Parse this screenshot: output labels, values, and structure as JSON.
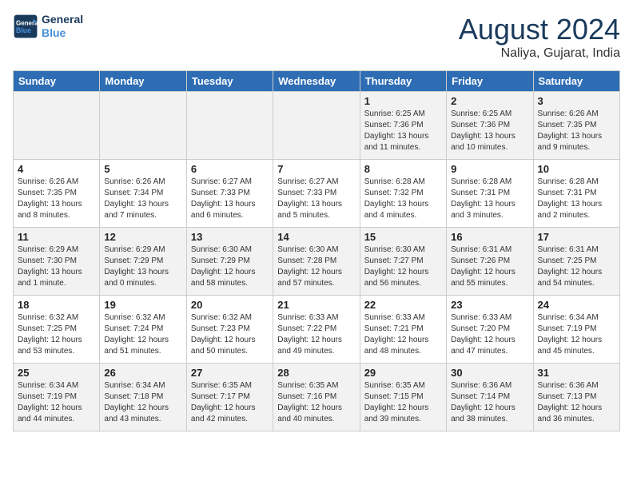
{
  "header": {
    "logo_line1": "General",
    "logo_line2": "Blue",
    "month_year": "August 2024",
    "location": "Naliya, Gujarat, India"
  },
  "days_of_week": [
    "Sunday",
    "Monday",
    "Tuesday",
    "Wednesday",
    "Thursday",
    "Friday",
    "Saturday"
  ],
  "weeks": [
    [
      {
        "day": "",
        "detail": ""
      },
      {
        "day": "",
        "detail": ""
      },
      {
        "day": "",
        "detail": ""
      },
      {
        "day": "",
        "detail": ""
      },
      {
        "day": "1",
        "detail": "Sunrise: 6:25 AM\nSunset: 7:36 PM\nDaylight: 13 hours\nand 11 minutes."
      },
      {
        "day": "2",
        "detail": "Sunrise: 6:25 AM\nSunset: 7:36 PM\nDaylight: 13 hours\nand 10 minutes."
      },
      {
        "day": "3",
        "detail": "Sunrise: 6:26 AM\nSunset: 7:35 PM\nDaylight: 13 hours\nand 9 minutes."
      }
    ],
    [
      {
        "day": "4",
        "detail": "Sunrise: 6:26 AM\nSunset: 7:35 PM\nDaylight: 13 hours\nand 8 minutes."
      },
      {
        "day": "5",
        "detail": "Sunrise: 6:26 AM\nSunset: 7:34 PM\nDaylight: 13 hours\nand 7 minutes."
      },
      {
        "day": "6",
        "detail": "Sunrise: 6:27 AM\nSunset: 7:33 PM\nDaylight: 13 hours\nand 6 minutes."
      },
      {
        "day": "7",
        "detail": "Sunrise: 6:27 AM\nSunset: 7:33 PM\nDaylight: 13 hours\nand 5 minutes."
      },
      {
        "day": "8",
        "detail": "Sunrise: 6:28 AM\nSunset: 7:32 PM\nDaylight: 13 hours\nand 4 minutes."
      },
      {
        "day": "9",
        "detail": "Sunrise: 6:28 AM\nSunset: 7:31 PM\nDaylight: 13 hours\nand 3 minutes."
      },
      {
        "day": "10",
        "detail": "Sunrise: 6:28 AM\nSunset: 7:31 PM\nDaylight: 13 hours\nand 2 minutes."
      }
    ],
    [
      {
        "day": "11",
        "detail": "Sunrise: 6:29 AM\nSunset: 7:30 PM\nDaylight: 13 hours\nand 1 minute."
      },
      {
        "day": "12",
        "detail": "Sunrise: 6:29 AM\nSunset: 7:29 PM\nDaylight: 13 hours\nand 0 minutes."
      },
      {
        "day": "13",
        "detail": "Sunrise: 6:30 AM\nSunset: 7:29 PM\nDaylight: 12 hours\nand 58 minutes."
      },
      {
        "day": "14",
        "detail": "Sunrise: 6:30 AM\nSunset: 7:28 PM\nDaylight: 12 hours\nand 57 minutes."
      },
      {
        "day": "15",
        "detail": "Sunrise: 6:30 AM\nSunset: 7:27 PM\nDaylight: 12 hours\nand 56 minutes."
      },
      {
        "day": "16",
        "detail": "Sunrise: 6:31 AM\nSunset: 7:26 PM\nDaylight: 12 hours\nand 55 minutes."
      },
      {
        "day": "17",
        "detail": "Sunrise: 6:31 AM\nSunset: 7:25 PM\nDaylight: 12 hours\nand 54 minutes."
      }
    ],
    [
      {
        "day": "18",
        "detail": "Sunrise: 6:32 AM\nSunset: 7:25 PM\nDaylight: 12 hours\nand 53 minutes."
      },
      {
        "day": "19",
        "detail": "Sunrise: 6:32 AM\nSunset: 7:24 PM\nDaylight: 12 hours\nand 51 minutes."
      },
      {
        "day": "20",
        "detail": "Sunrise: 6:32 AM\nSunset: 7:23 PM\nDaylight: 12 hours\nand 50 minutes."
      },
      {
        "day": "21",
        "detail": "Sunrise: 6:33 AM\nSunset: 7:22 PM\nDaylight: 12 hours\nand 49 minutes."
      },
      {
        "day": "22",
        "detail": "Sunrise: 6:33 AM\nSunset: 7:21 PM\nDaylight: 12 hours\nand 48 minutes."
      },
      {
        "day": "23",
        "detail": "Sunrise: 6:33 AM\nSunset: 7:20 PM\nDaylight: 12 hours\nand 47 minutes."
      },
      {
        "day": "24",
        "detail": "Sunrise: 6:34 AM\nSunset: 7:19 PM\nDaylight: 12 hours\nand 45 minutes."
      }
    ],
    [
      {
        "day": "25",
        "detail": "Sunrise: 6:34 AM\nSunset: 7:19 PM\nDaylight: 12 hours\nand 44 minutes."
      },
      {
        "day": "26",
        "detail": "Sunrise: 6:34 AM\nSunset: 7:18 PM\nDaylight: 12 hours\nand 43 minutes."
      },
      {
        "day": "27",
        "detail": "Sunrise: 6:35 AM\nSunset: 7:17 PM\nDaylight: 12 hours\nand 42 minutes."
      },
      {
        "day": "28",
        "detail": "Sunrise: 6:35 AM\nSunset: 7:16 PM\nDaylight: 12 hours\nand 40 minutes."
      },
      {
        "day": "29",
        "detail": "Sunrise: 6:35 AM\nSunset: 7:15 PM\nDaylight: 12 hours\nand 39 minutes."
      },
      {
        "day": "30",
        "detail": "Sunrise: 6:36 AM\nSunset: 7:14 PM\nDaylight: 12 hours\nand 38 minutes."
      },
      {
        "day": "31",
        "detail": "Sunrise: 6:36 AM\nSunset: 7:13 PM\nDaylight: 12 hours\nand 36 minutes."
      }
    ]
  ]
}
